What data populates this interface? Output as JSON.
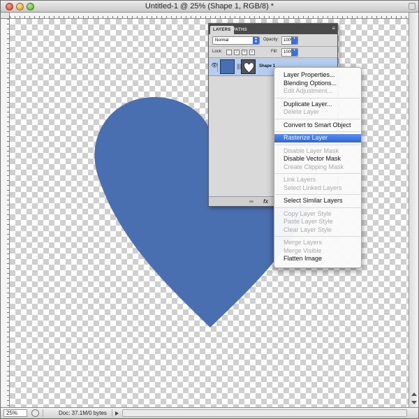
{
  "window": {
    "title": "Untitled-1 @ 25% (Shape 1, RGB/8) *"
  },
  "status_bar": {
    "zoom": "25%",
    "doc_info": "Doc: 37.1M/0 bytes"
  },
  "layers_panel": {
    "tabs": [
      {
        "label": "LAYERS",
        "active": true
      },
      {
        "label": "PATHS",
        "active": false
      }
    ],
    "blend_mode": "Normal",
    "opacity_label": "Opacity:",
    "opacity_value": "100%",
    "lock_label": "Lock:",
    "fill_label": "Fill:",
    "fill_value": "100%",
    "layer": {
      "name": "Shape 1",
      "color": "#4a6fb0"
    },
    "footer_icons": [
      "link-icon",
      "fx-icon"
    ]
  },
  "context_menu": {
    "groups": [
      [
        {
          "label": "Layer Properties...",
          "enabled": true
        },
        {
          "label": "Blending Options...",
          "enabled": true
        },
        {
          "label": "Edit Adjustment...",
          "enabled": false
        }
      ],
      [
        {
          "label": "Duplicate Layer...",
          "enabled": true
        },
        {
          "label": "Delete Layer",
          "enabled": false
        }
      ],
      [
        {
          "label": "Convert to Smart Object",
          "enabled": true
        }
      ],
      [
        {
          "label": "Rasterize Layer",
          "enabled": true,
          "highlighted": true
        }
      ],
      [
        {
          "label": "Disable Layer Mask",
          "enabled": false
        },
        {
          "label": "Disable Vector Mask",
          "enabled": true
        },
        {
          "label": "Create Clipping Mask",
          "enabled": false
        }
      ],
      [
        {
          "label": "Link Layers",
          "enabled": false
        },
        {
          "label": "Select Linked Layers",
          "enabled": false
        }
      ],
      [
        {
          "label": "Select Similar Layers",
          "enabled": true
        }
      ],
      [
        {
          "label": "Copy Layer Style",
          "enabled": false
        },
        {
          "label": "Paste Layer Style",
          "enabled": false
        },
        {
          "label": "Clear Layer Style",
          "enabled": false
        }
      ],
      [
        {
          "label": "Merge Layers",
          "enabled": false
        },
        {
          "label": "Merge Visible",
          "enabled": false
        },
        {
          "label": "Flatten Image",
          "enabled": true
        }
      ]
    ]
  },
  "colors": {
    "shape_fill": "#4a6fb0",
    "menu_highlight": "#2d62df",
    "layer_selected": "#b6cdf0"
  }
}
